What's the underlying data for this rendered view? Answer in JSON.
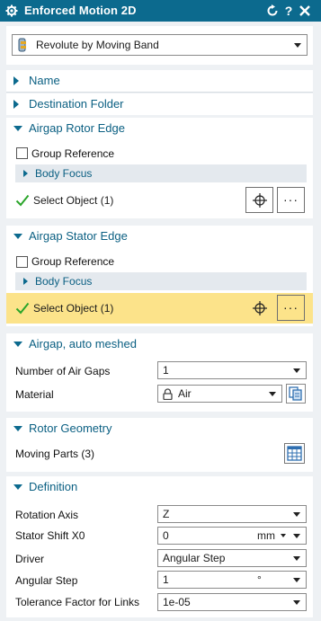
{
  "window": {
    "title": "Enforced Motion 2D",
    "colors": {
      "titlebar": "#0c6a8e",
      "accent": "#0a5f82",
      "highlight": "#fce38a",
      "check": "#2aa52a"
    }
  },
  "type_selector": {
    "value": "Revolute by Moving Band",
    "icon": "revolute-icon"
  },
  "sections": {
    "name": {
      "label": "Name",
      "expanded": false
    },
    "destination": {
      "label": "Destination Folder",
      "expanded": false
    },
    "rotor_edge": {
      "label": "Airgap Rotor Edge",
      "group_reference": "Group Reference",
      "body_focus": "Body Focus",
      "select_object": "Select Object (1)"
    },
    "stator_edge": {
      "label": "Airgap Stator Edge",
      "group_reference": "Group Reference",
      "body_focus": "Body Focus",
      "select_object": "Select Object (1)"
    },
    "airgap": {
      "label": "Airgap, auto meshed",
      "air_gaps_label": "Number of Air Gaps",
      "air_gaps_value": "1",
      "material_label": "Material",
      "material_value": "Air"
    },
    "rotor_geometry": {
      "label": "Rotor Geometry",
      "moving_parts": "Moving Parts (3)"
    },
    "definition": {
      "label": "Definition",
      "rotation_axis_label": "Rotation Axis",
      "rotation_axis_value": "Z",
      "stator_shift_label": "Stator Shift X0",
      "stator_shift_value": "0",
      "stator_shift_unit": "mm",
      "driver_label": "Driver",
      "driver_value": "Angular Step",
      "angular_step_label": "Angular Step",
      "angular_step_value": "1",
      "angular_step_unit": "°",
      "tolerance_label": "Tolerance Factor for Links",
      "tolerance_value": "1e-05"
    }
  }
}
